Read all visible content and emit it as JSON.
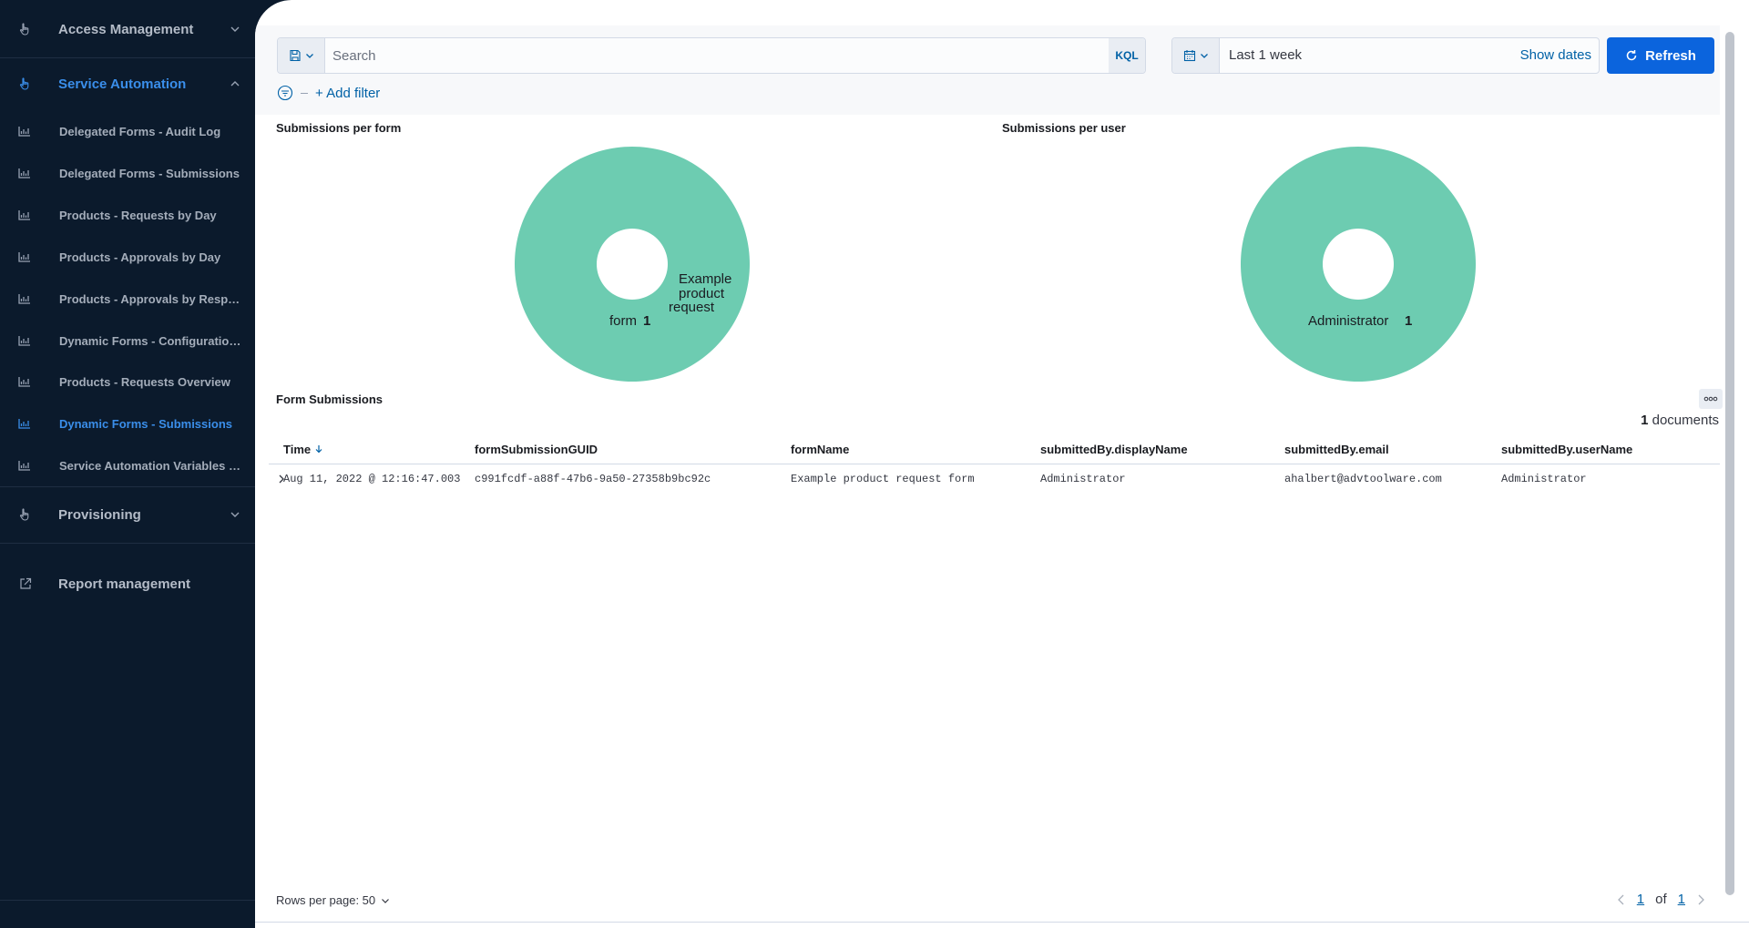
{
  "sidebar": {
    "sections": [
      {
        "label": "Access Management",
        "icon": "hand-pointer-icon"
      },
      {
        "label": "Service Automation",
        "icon": "hand-pointer-icon"
      },
      {
        "label": "Provisioning",
        "icon": "hand-pointer-icon"
      },
      {
        "label": "Report management",
        "icon": "external-link-icon"
      }
    ],
    "items": [
      {
        "label": "Delegated Forms - Audit Log"
      },
      {
        "label": "Delegated Forms - Submissions"
      },
      {
        "label": "Products - Requests by Day"
      },
      {
        "label": "Products - Approvals by Day"
      },
      {
        "label": "Products - Approvals by Response"
      },
      {
        "label": "Dynamic Forms - Configuration Overview"
      },
      {
        "label": "Products - Requests Overview"
      },
      {
        "label": "Dynamic Forms - Submissions"
      },
      {
        "label": "Service Automation Variables - Overview"
      }
    ]
  },
  "topbar": {
    "search_placeholder": "Search",
    "kql": "KQL",
    "date_range": "Last 1 week",
    "show_dates": "Show dates",
    "refresh": "Refresh",
    "add_filter": "+ Add filter"
  },
  "colors": {
    "accent": "#0b64dd",
    "slice": "#6dccb1",
    "active": "#3a8eea"
  },
  "chart_data": [
    {
      "type": "pie",
      "title": "Submissions per form",
      "slices": [
        {
          "label": "Example product request form",
          "value": 1
        }
      ],
      "label_text": {
        "line1": "Example",
        "line2": "product",
        "line3": "request",
        "line4": "form",
        "value": "1"
      }
    },
    {
      "type": "pie",
      "title": "Submissions per user",
      "slices": [
        {
          "label": "Administrator",
          "value": 1
        }
      ],
      "label_text": {
        "name": "Administrator",
        "value": "1"
      }
    }
  ],
  "table": {
    "title": "Form Submissions",
    "count": "1",
    "count_suffix": "documents",
    "headers": [
      "Time",
      "formSubmissionGUID",
      "formName",
      "submittedBy.displayName",
      "submittedBy.email",
      "submittedBy.userName"
    ],
    "rows": [
      [
        "Aug 11, 2022 @ 12:16:47.003",
        "c991fcdf-a88f-47b6-9a50-27358b9bc92c",
        "Example product request form",
        "Administrator",
        "ahalbert@advtoolware.com",
        "Administrator"
      ]
    ]
  },
  "footer": {
    "rows_per_page": "Rows per page: 50",
    "page_current": "1",
    "page_of": "of",
    "page_total": "1"
  }
}
